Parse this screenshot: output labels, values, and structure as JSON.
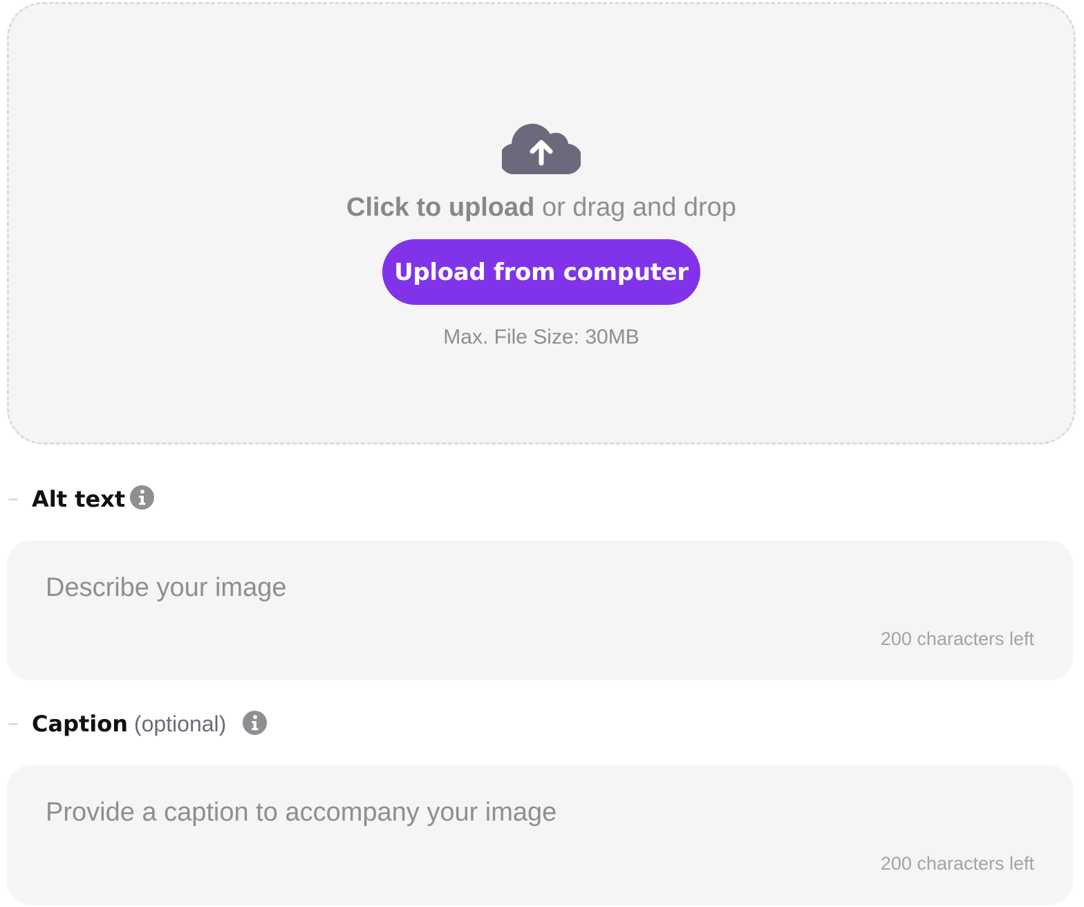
{
  "upload": {
    "icon": "cloud-upload-icon",
    "prompt_strong": "Click to upload",
    "prompt_rest": " or drag and drop",
    "button_label": "Upload from computer",
    "max_size": "Max. File Size: 30MB"
  },
  "alt_text": {
    "label": "Alt text",
    "info_icon": "info-icon",
    "placeholder": "Describe your image",
    "value": "",
    "counter": "200 characters left"
  },
  "caption": {
    "label": "Caption",
    "optional": " (optional)",
    "info_icon": "info-icon",
    "placeholder": "Provide a caption to accompany your image",
    "value": "",
    "counter": "200 characters left"
  },
  "colors": {
    "accent": "#8133e9",
    "panel_bg": "#f5f5f5",
    "icon_gray": "#6b6a7c",
    "muted_text": "#8e8e93"
  }
}
